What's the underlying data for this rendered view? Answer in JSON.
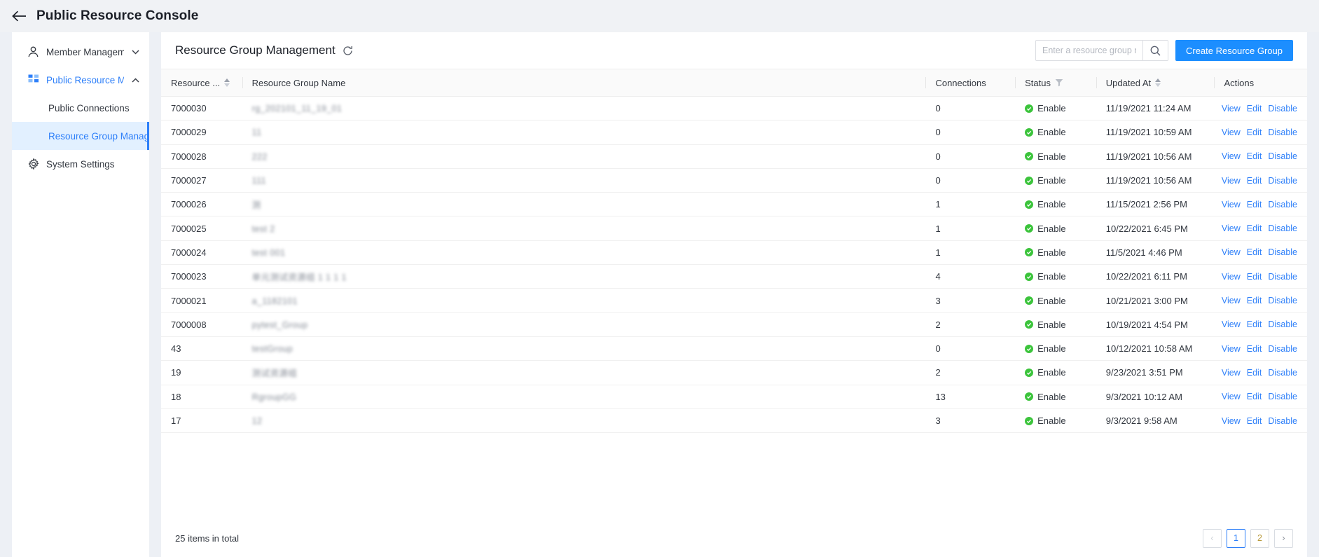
{
  "topbar": {
    "back_icon": "arrow-left-icon",
    "title": "Public Resource Console"
  },
  "sidebar": {
    "groups": [
      {
        "icon": "user-icon",
        "label": "Member Managem...",
        "caret": "chevron-down-icon",
        "expanded": false,
        "active": false,
        "children": []
      },
      {
        "icon": "grid-icon",
        "label": "Public Resource Ma...",
        "caret": "chevron-up-icon",
        "expanded": true,
        "active": true,
        "children": [
          {
            "label": "Public Connections",
            "selected": false
          },
          {
            "label": "Resource Group Manag...",
            "selected": true
          }
        ]
      },
      {
        "icon": "gear-icon",
        "label": "System Settings",
        "caret": "",
        "expanded": false,
        "active": false,
        "children": []
      }
    ]
  },
  "main": {
    "page_title": "Resource Group Management",
    "refresh_icon": "refresh-icon",
    "search": {
      "placeholder": "Enter a resource group n...",
      "value": "",
      "icon": "search-icon"
    },
    "create_button": "Create Resource Group",
    "columns": [
      {
        "key": "id",
        "label": "Resource ...",
        "sortable": true,
        "filterable": false
      },
      {
        "key": "name",
        "label": "Resource Group Name",
        "sortable": false,
        "filterable": false
      },
      {
        "key": "connections",
        "label": "Connections",
        "sortable": false,
        "filterable": false
      },
      {
        "key": "status",
        "label": "Status",
        "sortable": false,
        "filterable": true
      },
      {
        "key": "updated",
        "label": "Updated At",
        "sortable": true,
        "filterable": false
      },
      {
        "key": "actions",
        "label": "Actions",
        "sortable": false,
        "filterable": false
      }
    ],
    "actions": [
      "View",
      "Edit",
      "Disable"
    ],
    "rows": [
      {
        "id": "7000030",
        "name": "rg_202101_11_19_01",
        "redacted": true,
        "connections": "0",
        "status": "Enable",
        "updated": "11/19/2021 11:24 AM"
      },
      {
        "id": "7000029",
        "name": "11",
        "redacted": true,
        "connections": "0",
        "status": "Enable",
        "updated": "11/19/2021 10:59 AM"
      },
      {
        "id": "7000028",
        "name": "222",
        "redacted": true,
        "connections": "0",
        "status": "Enable",
        "updated": "11/19/2021 10:56 AM"
      },
      {
        "id": "7000027",
        "name": "111",
        "redacted": true,
        "connections": "0",
        "status": "Enable",
        "updated": "11/19/2021 10:56 AM"
      },
      {
        "id": "7000026",
        "name": "测",
        "redacted": true,
        "connections": "1",
        "status": "Enable",
        "updated": "11/15/2021 2:56 PM"
      },
      {
        "id": "7000025",
        "name": "test 2",
        "redacted": true,
        "connections": "1",
        "status": "Enable",
        "updated": "10/22/2021 6:45 PM"
      },
      {
        "id": "7000024",
        "name": "test  001",
        "redacted": true,
        "connections": "1",
        "status": "Enable",
        "updated": "11/5/2021 4:46 PM"
      },
      {
        "id": "7000023",
        "name": "单元测试资源组 1 1 1 1",
        "redacted": true,
        "connections": "4",
        "status": "Enable",
        "updated": "10/22/2021 6:11 PM"
      },
      {
        "id": "7000021",
        "name": "a_1182101",
        "redacted": true,
        "connections": "3",
        "status": "Enable",
        "updated": "10/21/2021 3:00 PM"
      },
      {
        "id": "7000008",
        "name": "pytest_Group",
        "redacted": true,
        "connections": "2",
        "status": "Enable",
        "updated": "10/19/2021 4:54 PM"
      },
      {
        "id": "43",
        "name": "testGroup",
        "redacted": true,
        "connections": "0",
        "status": "Enable",
        "updated": "10/12/2021 10:58 AM"
      },
      {
        "id": "19",
        "name": "测试资源组",
        "redacted": true,
        "connections": "2",
        "status": "Enable",
        "updated": "9/23/2021 3:51 PM"
      },
      {
        "id": "18",
        "name": "RgroupGG",
        "redacted": true,
        "connections": "13",
        "status": "Enable",
        "updated": "9/3/2021 10:12 AM"
      },
      {
        "id": "17",
        "name": "12",
        "redacted": true,
        "connections": "3",
        "status": "Enable",
        "updated": "9/3/2021 9:58 AM"
      }
    ],
    "footer": {
      "total_text": "25 items in total",
      "pages": [
        {
          "label": "‹",
          "type": "prev",
          "disabled": true,
          "current": false
        },
        {
          "label": "1",
          "type": "page",
          "disabled": false,
          "current": true
        },
        {
          "label": "2",
          "type": "page",
          "disabled": false,
          "current": false
        },
        {
          "label": "›",
          "type": "next",
          "disabled": false,
          "current": false
        }
      ]
    }
  },
  "colors": {
    "accent": "#2d7ff9",
    "primary_button": "#1c8eff",
    "status_ok": "#3cc43c",
    "page_bg": "#edf0f5",
    "card_bg": "#ffffff"
  }
}
